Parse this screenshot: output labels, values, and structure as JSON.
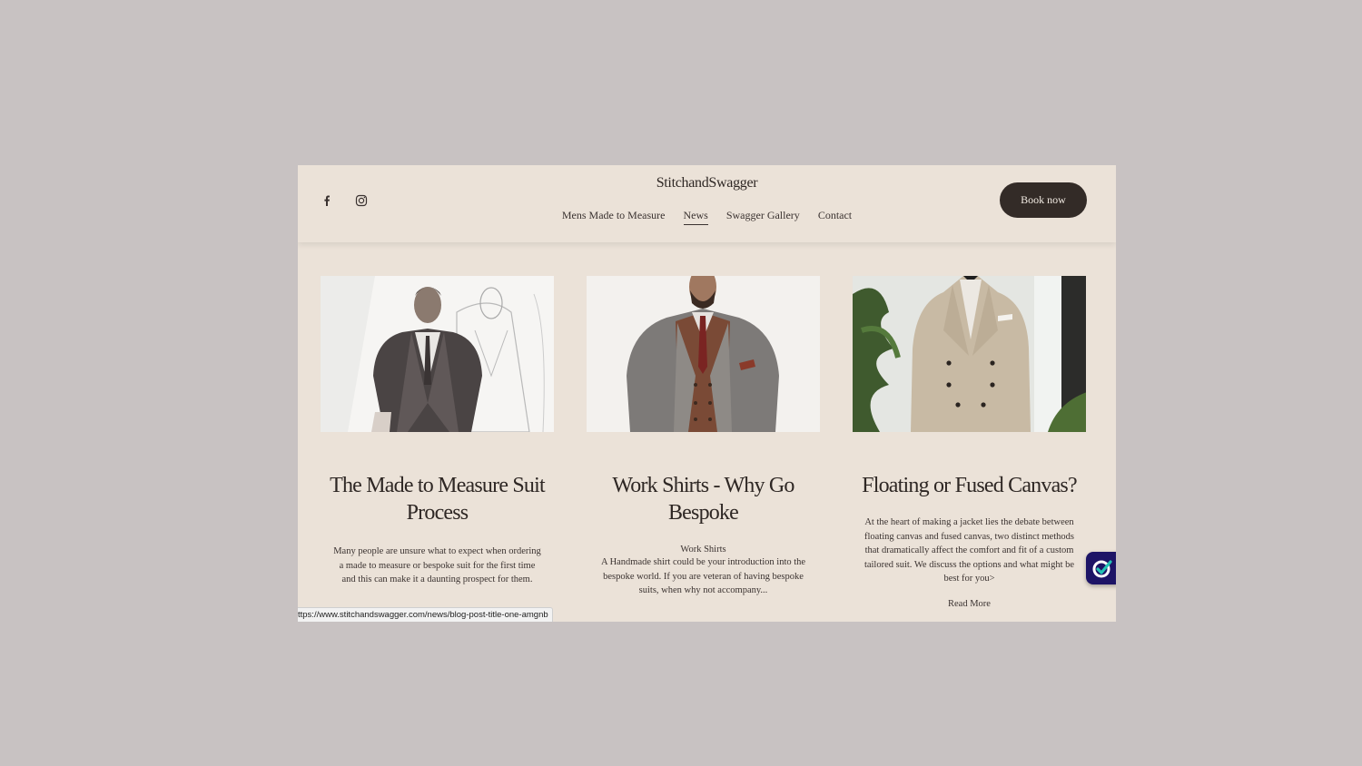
{
  "brand": "StitchandSwagger",
  "nav": {
    "items": [
      {
        "label": "Mens Made to Measure"
      },
      {
        "label": "News"
      },
      {
        "label": "Swagger Gallery"
      },
      {
        "label": "Contact"
      }
    ],
    "active": "News"
  },
  "book_button": "Book now",
  "social_icons": [
    "facebook-icon",
    "instagram-icon"
  ],
  "posts": [
    {
      "title_line1": "The Made to Measure Suit",
      "title_line2": "Process",
      "category": "",
      "excerpt": "Many people are unsure what to expect when ordering a made to measure or bespoke suit for the first time and this can make it a daunting prospect for them.",
      "read_more": ""
    },
    {
      "title_line1": "Work Shirts - Why Go",
      "title_line2": "Bespoke",
      "category": "Work Shirts",
      "excerpt": "A Handmade shirt could be your introduction into the bespoke world. If you are veteran of having bespoke suits, when why not accompany...",
      "read_more": ""
    },
    {
      "title_line1": "Floating or Fused Canvas?",
      "title_line2": "",
      "category": "",
      "excerpt": "At the heart of  making a jacket lies the debate between floating canvas and fused canvas, two distinct methods that dramatically affect the comfort and fit of a custom tailored suit. We discuss the options and what might be best for you>",
      "read_more": "Read More"
    }
  ],
  "status_url": "ttps://www.stitchandswagger.com/news/blog-post-title-one-amgnb",
  "colors": {
    "page_bg": "#ebe2d8",
    "button_bg": "#332b27",
    "widget_bg": "#1d1466",
    "widget_accent": "#22c3b5"
  }
}
